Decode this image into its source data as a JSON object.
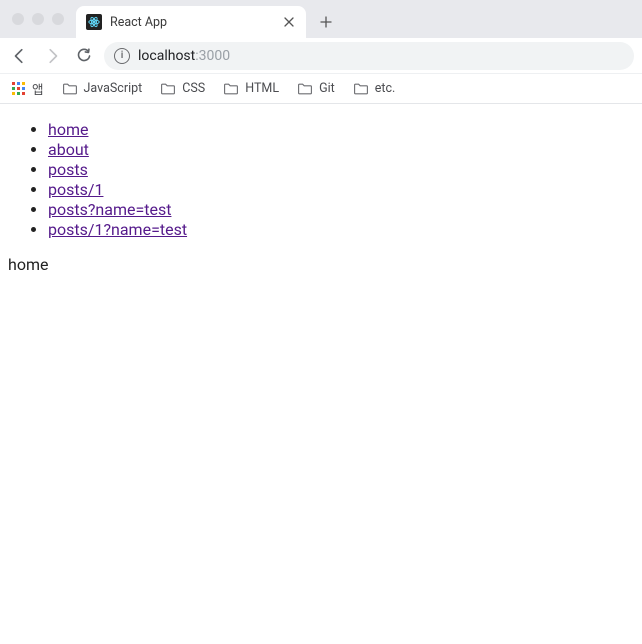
{
  "window": {
    "tab_title": "React App"
  },
  "address": {
    "host": "localhost",
    "port": ":3000"
  },
  "bookmarks": {
    "apps_label": "앱",
    "folders": [
      "JavaScript",
      "CSS",
      "HTML",
      "Git",
      "etc."
    ]
  },
  "apps_grid_colors": [
    "#e34133",
    "#4285f4",
    "#fabb05",
    "#34a853",
    "#e34133",
    "#4285f4",
    "#fabb05",
    "#34a853",
    "#e34133"
  ],
  "page": {
    "nav_links": [
      "home",
      "about",
      "posts",
      "posts/1",
      "posts?name=test",
      "posts/1?name=test"
    ],
    "current_route_text": "home"
  }
}
